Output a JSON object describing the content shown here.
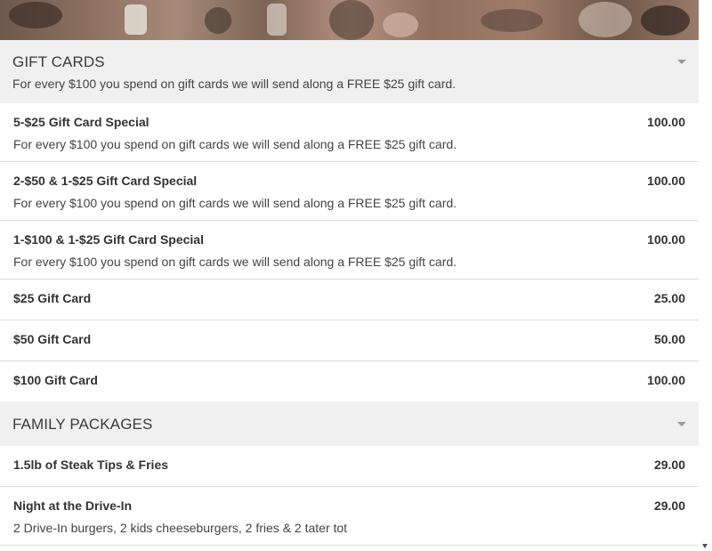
{
  "sections": [
    {
      "title": "GIFT CARDS",
      "description": "For every $100 you spend on gift cards we will send along a FREE $25 gift card.",
      "items": [
        {
          "name": "5-$25 Gift Card Special",
          "price": "100.00",
          "description": "For every $100 you spend on gift cards we will send along a FREE $25 gift card."
        },
        {
          "name": "2-$50 & 1-$25 Gift Card Special",
          "price": "100.00",
          "description": "For every $100 you spend on gift cards we will send along a FREE $25 gift card."
        },
        {
          "name": "1-$100 & 1-$25 Gift Card Special",
          "price": "100.00",
          "description": "For every $100 you spend on gift cards we will send along a FREE $25 gift card."
        },
        {
          "name": "$25 Gift Card",
          "price": "25.00"
        },
        {
          "name": "$50 Gift Card",
          "price": "50.00"
        },
        {
          "name": "$100 Gift Card",
          "price": "100.00"
        }
      ]
    },
    {
      "title": "FAMILY PACKAGES",
      "items": [
        {
          "name": "1.5lb of Steak Tips & Fries",
          "price": "29.00"
        },
        {
          "name": "Night at the Drive-In",
          "price": "29.00",
          "description": "2 Drive-In burgers, 2 kids cheeseburgers, 2 fries & 2 tater tot"
        }
      ]
    }
  ]
}
